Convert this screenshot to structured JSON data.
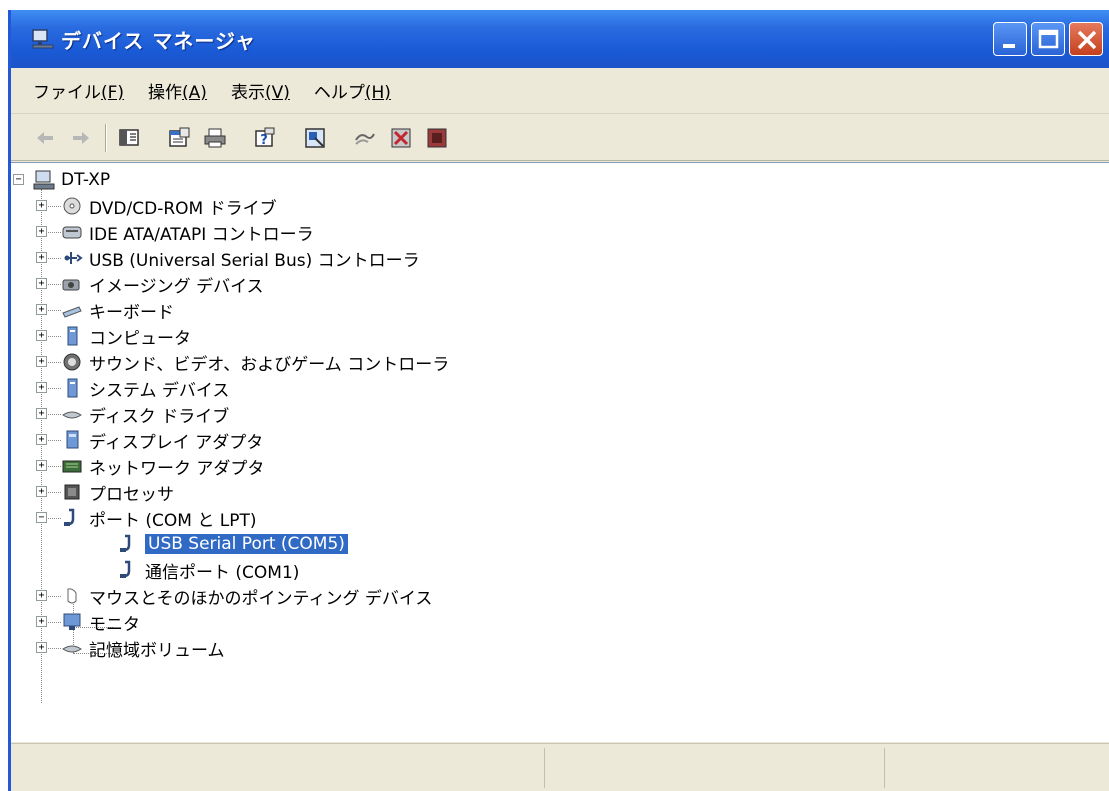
{
  "window": {
    "title": "デバイス マネージャ",
    "controls": {
      "minimize": "minimize",
      "maximize": "maximize",
      "close": "close"
    }
  },
  "menu": [
    {
      "label": "ファイル",
      "accel": "(F)"
    },
    {
      "label": "操作",
      "accel": "(A)"
    },
    {
      "label": "表示",
      "accel": "(V)"
    },
    {
      "label": "ヘルプ",
      "accel": "(H)"
    }
  ],
  "toolbar": [
    {
      "name": "back-icon"
    },
    {
      "name": "forward-icon"
    },
    {
      "name": "show-hide-tree-icon"
    },
    {
      "name": "properties-icon"
    },
    {
      "name": "print-icon"
    },
    {
      "name": "help-icon"
    },
    {
      "name": "scan-hardware-icon"
    },
    {
      "name": "update-driver-icon"
    },
    {
      "name": "disable-device-icon"
    },
    {
      "name": "uninstall-device-icon"
    }
  ],
  "tree": {
    "root": "DT-XP",
    "categories": [
      "DVD/CD-ROM ドライブ",
      "IDE ATA/ATAPI コントローラ",
      "USB (Universal Serial Bus) コントローラ",
      "イメージング デバイス",
      "キーボード",
      "コンピュータ",
      "サウンド、ビデオ、およびゲーム コントローラ",
      "システム デバイス",
      "ディスク ドライブ",
      "ディスプレイ アダプタ",
      "ネットワーク アダプタ",
      "プロセッサ",
      "ポート (COM と LPT)",
      "マウスとそのほかのポインティング デバイス",
      "モニタ",
      "記憶域ボリューム"
    ],
    "ports_children": [
      "USB Serial Port (COM5)",
      "通信ポート (COM1)"
    ],
    "selected": "USB Serial Port (COM5)"
  },
  "colors": {
    "titlebar": "#2a6be0",
    "selection": "#316ac5",
    "chrome": "#ece9d8"
  }
}
